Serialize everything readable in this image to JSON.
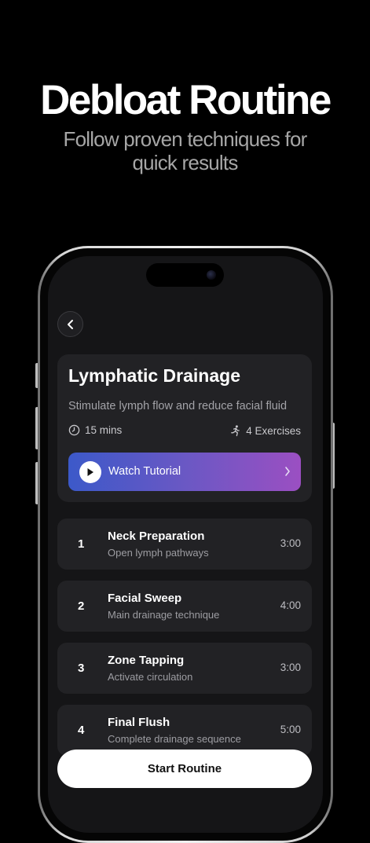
{
  "promo": {
    "title": "Debloat Routine",
    "subtitle_line1": "Follow proven techniques for",
    "subtitle_line2": "quick results"
  },
  "routine": {
    "title": "Lymphatic Drainage",
    "description": "Stimulate lymph flow and reduce facial fluid",
    "duration": "15 mins",
    "exercises": "4 Exercises",
    "tutorial_label": "Watch Tutorial"
  },
  "steps": [
    {
      "number": "1",
      "title": "Neck Preparation",
      "subtitle": "Open lymph pathways",
      "duration": "3:00"
    },
    {
      "number": "2",
      "title": "Facial Sweep",
      "subtitle": "Main drainage technique",
      "duration": "4:00"
    },
    {
      "number": "3",
      "title": "Zone Tapping",
      "subtitle": "Activate circulation",
      "duration": "3:00"
    },
    {
      "number": "4",
      "title": "Final Flush",
      "subtitle": "Complete drainage sequence",
      "duration": "5:00"
    }
  ],
  "actions": {
    "start_label": "Start Routine"
  },
  "colors": {
    "background": "#000000",
    "card": "#222225",
    "tutorial_gradient_start": "#3c59c9",
    "tutorial_gradient_end": "#9b4fc2"
  }
}
